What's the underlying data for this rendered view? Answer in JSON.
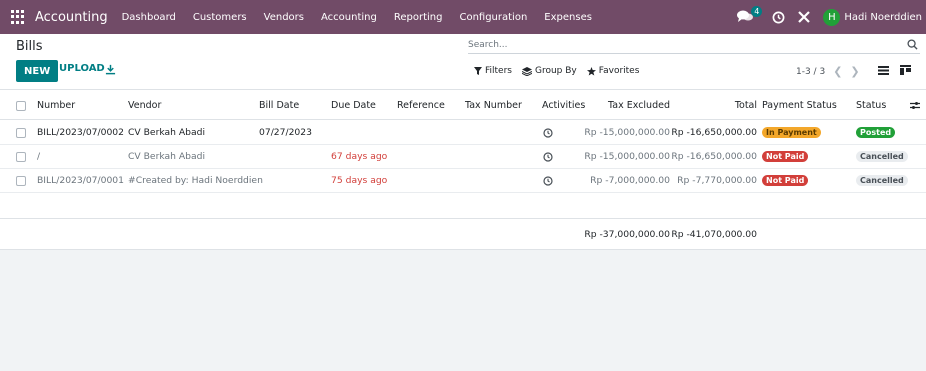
{
  "navbar": {
    "app_name": "Accounting",
    "menu": [
      "Dashboard",
      "Customers",
      "Vendors",
      "Accounting",
      "Reporting",
      "Configuration",
      "Expenses"
    ],
    "chat_count": "4",
    "user_initial": "H",
    "user_name": "Hadi Noerddien",
    "brand_color": "#714b67"
  },
  "control_panel": {
    "breadcrumb": "Bills",
    "search_placeholder": "Search...",
    "new_label": "NEW",
    "upload_label": "UPLOAD",
    "filters_label": "Filters",
    "group_by_label": "Group By",
    "favorites_label": "Favorites",
    "pager": "1-3 / 3"
  },
  "table": {
    "columns": [
      "Number",
      "Vendor",
      "Bill Date",
      "Due Date",
      "Reference",
      "Tax Number",
      "Activities",
      "Tax Excluded",
      "Total",
      "Payment Status",
      "Status"
    ],
    "rows": [
      {
        "number": "BILL/2023/07/0002",
        "vendor": "CV Berkah Abadi",
        "bill_date": "07/27/2023",
        "due_date": "",
        "tax_excluded": "Rp -15,000,000.00",
        "total": "Rp -16,650,000.00",
        "payment_status": "In Payment",
        "status": "Posted"
      },
      {
        "number": "/",
        "vendor": "CV Berkah Abadi",
        "bill_date": "",
        "due_date": "67 days ago",
        "tax_excluded": "Rp -15,000,000.00",
        "total": "Rp -16,650,000.00",
        "payment_status": "Not Paid",
        "status": "Cancelled"
      },
      {
        "number": "BILL/2023/07/0001",
        "vendor": "#Created by: Hadi Noerddien",
        "bill_date": "",
        "due_date": "75 days ago",
        "tax_excluded": "Rp -7,000,000.00",
        "total": "Rp -7,770,000.00",
        "payment_status": "Not Paid",
        "status": "Cancelled"
      }
    ],
    "totals": {
      "tax_excluded": "Rp -37,000,000.00",
      "total": "Rp -41,070,000.00"
    }
  },
  "colors": {
    "accent": "#017e84",
    "danger": "#d23f3a",
    "success": "#21a038",
    "warning": "#f3a72a"
  }
}
